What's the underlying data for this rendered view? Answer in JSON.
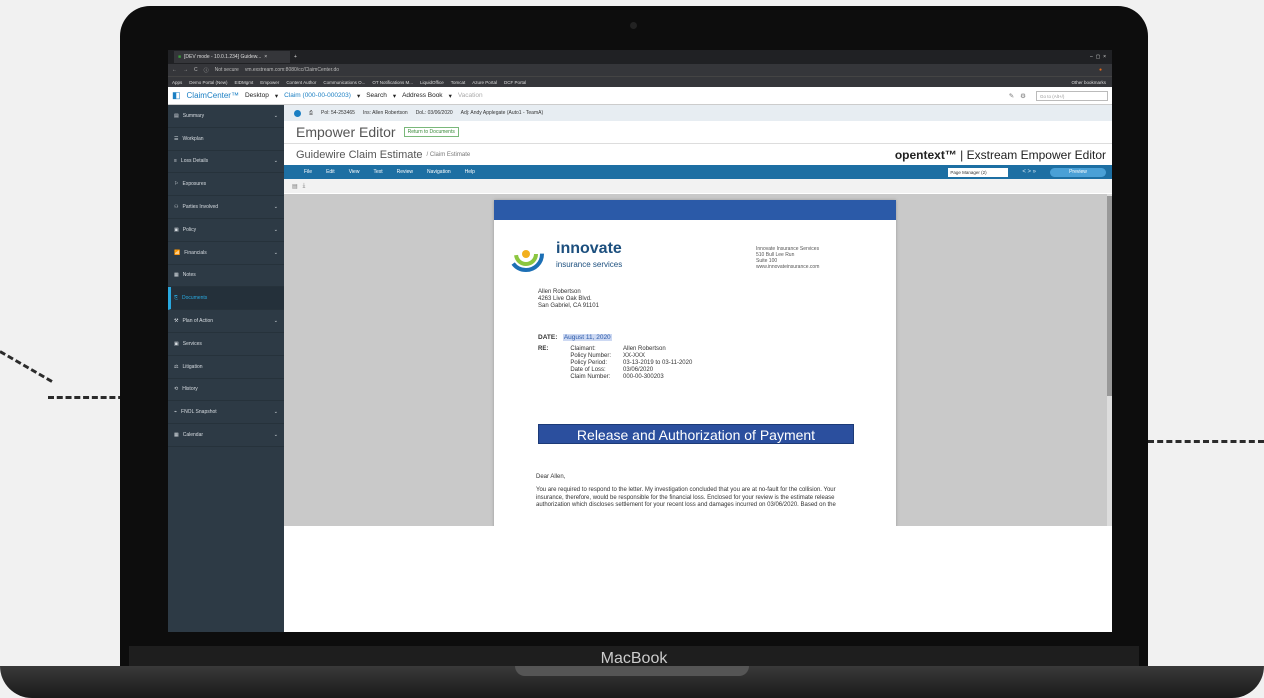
{
  "browser": {
    "tab_title": "[DEV mode - 10.0.1.234] Guidew...",
    "new_tab": "+",
    "security": "Not secure",
    "url": "vm.exstream.com:8080/cc/ClaimCenter.do",
    "bookmarks": [
      "Apps",
      "Demo Portal (New)",
      "EIDMgmt",
      "Empower",
      "Content Author",
      "Communications O...",
      "OT Notifications M...",
      "LiquidOffice",
      "Tomcat",
      "Azure Portal",
      "DCF Portal"
    ],
    "other_bookmarks": "Other bookmarks"
  },
  "app": {
    "brand": "ClaimCenter™",
    "desktop": "Desktop",
    "claim": "Claim (000-00-000203)",
    "search": "Search",
    "address_book": "Address Book",
    "vacation": "Vacation",
    "goto_placeholder": "Go to (Alt+/)"
  },
  "sidebar": [
    {
      "label": "Summary",
      "chev": "⌄"
    },
    {
      "label": "Workplan",
      "chev": ""
    },
    {
      "label": "Loss Details",
      "chev": "⌄"
    },
    {
      "label": "Exposures",
      "chev": ""
    },
    {
      "label": "Parties Involved",
      "chev": "⌄"
    },
    {
      "label": "Policy",
      "chev": "⌄"
    },
    {
      "label": "Financials",
      "chev": "⌄"
    },
    {
      "label": "Notes",
      "chev": ""
    },
    {
      "label": "Documents",
      "chev": ""
    },
    {
      "label": "Plan of Action",
      "chev": "⌄"
    },
    {
      "label": "Services",
      "chev": ""
    },
    {
      "label": "Litigation",
      "chev": ""
    },
    {
      "label": "History",
      "chev": ""
    },
    {
      "label": "FNOL Snapshot",
      "chev": "⌄"
    },
    {
      "label": "Calendar",
      "chev": "⌄"
    }
  ],
  "infobar": {
    "pol": "Pol: 54-253465",
    "ins": "Ins: Allen Robertson",
    "dol": "DoL: 03/06/2020",
    "adj": "Adj: Andy Applegate (Auto1 - TeamA)"
  },
  "editor": {
    "title": "Empower Editor",
    "return": "Return to Documents",
    "doc_title": "Guidewire Claim Estimate",
    "doc_sub": "/ Claim Estimate",
    "brand_bold": "opentext™",
    "brand_rest": "| Exstream Empower Editor"
  },
  "menu": {
    "items": [
      "File",
      "Edit",
      "View",
      "Text",
      "Review",
      "Navigation",
      "Help"
    ],
    "page_manager": "Page Manager (2)",
    "nav": "<  >  »",
    "preview": "Preview"
  },
  "letter": {
    "company": "innovate",
    "company_sub": "insurance services",
    "sender_addr": [
      "Innovate Insurance Services",
      "510 Bull Lee Run",
      "Suite 100",
      "www.innovateinsurance.com"
    ],
    "recipient": [
      "Allen Robertson",
      "4263 Live Oak Blvd.",
      "San Gabriel, CA 91101"
    ],
    "date_label": "DATE:",
    "date_value": "August 11, 2020",
    "re_label": "RE:",
    "re_keys": [
      "Claimant:",
      "Policy Number:",
      "Policy Period:",
      "Date of Loss:",
      "Claim Number:"
    ],
    "re_vals": [
      "Allen Robertson",
      "XX-XXX",
      "03-13-2019 to 03-11-2020",
      "03/06/2020",
      "000-00-300203"
    ],
    "banner": "Release and Authorization of Payment",
    "greeting": "Dear Allen,",
    "body": "You are required to respond to the letter.  My investigation concluded that you are at no-fault for the collision.  Your insurance, therefore, would be responsible for the financial loss. Enclosed for your review is the estimate release authorization which discloses settlement for your recent loss and damages incurred on 03/06/2020. Based on the"
  },
  "device": {
    "label": "MacBook"
  }
}
